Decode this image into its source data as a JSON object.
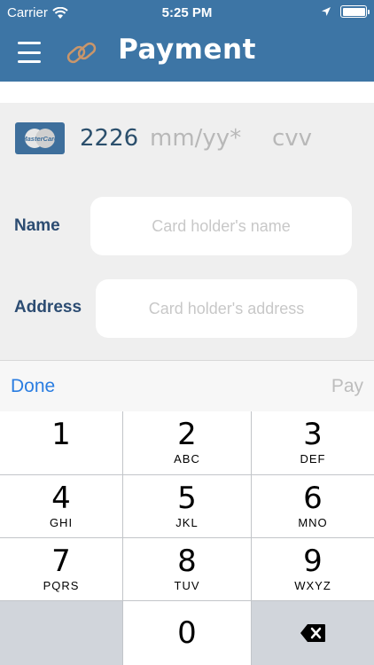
{
  "status_bar": {
    "carrier": "Carrier",
    "time": "5:25 PM",
    "wifi_icon": "wifi-icon",
    "location_icon": "location-arrow-icon",
    "battery_icon": "battery-icon"
  },
  "nav": {
    "title": "Payment",
    "menu_icon": "hamburger-menu-icon",
    "link_icon": "link-icon"
  },
  "card": {
    "brand": "MasterCard",
    "number": "2226",
    "expiry_placeholder": "mm/yy*",
    "cvv_placeholder": "cvv"
  },
  "form": {
    "name_label": "Name",
    "name_placeholder": "Card holder's name",
    "address_label": "Address",
    "address_placeholder": "Card holder's address"
  },
  "toolbar": {
    "done_label": "Done",
    "pay_label": "Pay"
  },
  "keypad": {
    "keys": [
      {
        "num": "1",
        "letters": ""
      },
      {
        "num": "2",
        "letters": "ABC"
      },
      {
        "num": "3",
        "letters": "DEF"
      },
      {
        "num": "4",
        "letters": "GHI"
      },
      {
        "num": "5",
        "letters": "JKL"
      },
      {
        "num": "6",
        "letters": "MNO"
      },
      {
        "num": "7",
        "letters": "PQRS"
      },
      {
        "num": "8",
        "letters": "TUV"
      },
      {
        "num": "9",
        "letters": "WXYZ"
      },
      {
        "num": "0",
        "letters": ""
      }
    ],
    "delete_icon": "backspace-icon"
  },
  "colors": {
    "header": "#3d75a5",
    "label": "#2c4c72",
    "accent": "#2a7de1"
  }
}
